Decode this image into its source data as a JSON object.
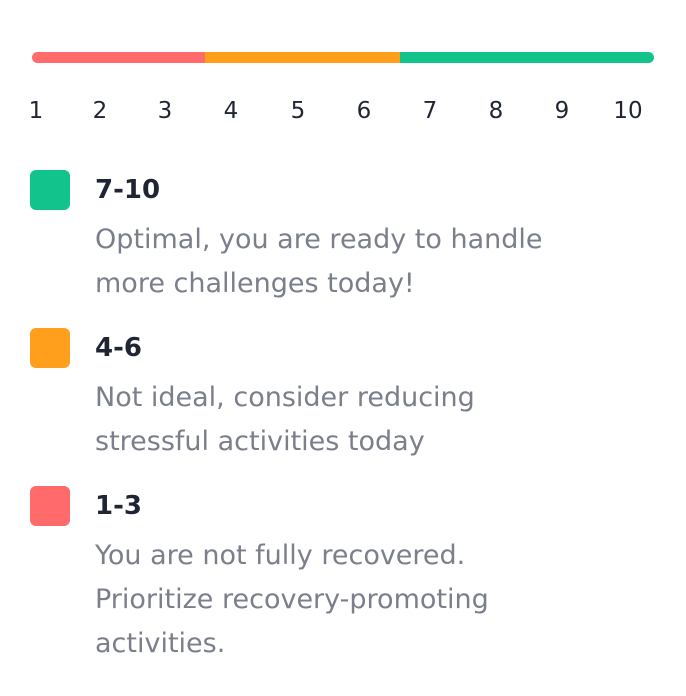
{
  "scale": {
    "segments": [
      {
        "from": 1,
        "to": 3,
        "color": "#ff6b6b"
      },
      {
        "from": 4,
        "to": 6,
        "color": "#ff9f1c"
      },
      {
        "from": 7,
        "to": 10,
        "color": "#12c48b"
      }
    ],
    "numbers": [
      "1",
      "2",
      "3",
      "4",
      "5",
      "6",
      "7",
      "8",
      "9",
      "10"
    ]
  },
  "legend": [
    {
      "range": "7-10",
      "color": "#12c48b",
      "lines": [
        "Optimal, you are ready to handle",
        "more challenges today!"
      ]
    },
    {
      "range": "4-6",
      "color": "#ff9f1c",
      "lines": [
        "Not ideal, consider reducing",
        "stressful activities today"
      ]
    },
    {
      "range": "1-3",
      "color": "#ff6b6b",
      "lines": [
        "You are not fully recovered.",
        "Prioritize recovery-promoting",
        "activities."
      ]
    }
  ]
}
